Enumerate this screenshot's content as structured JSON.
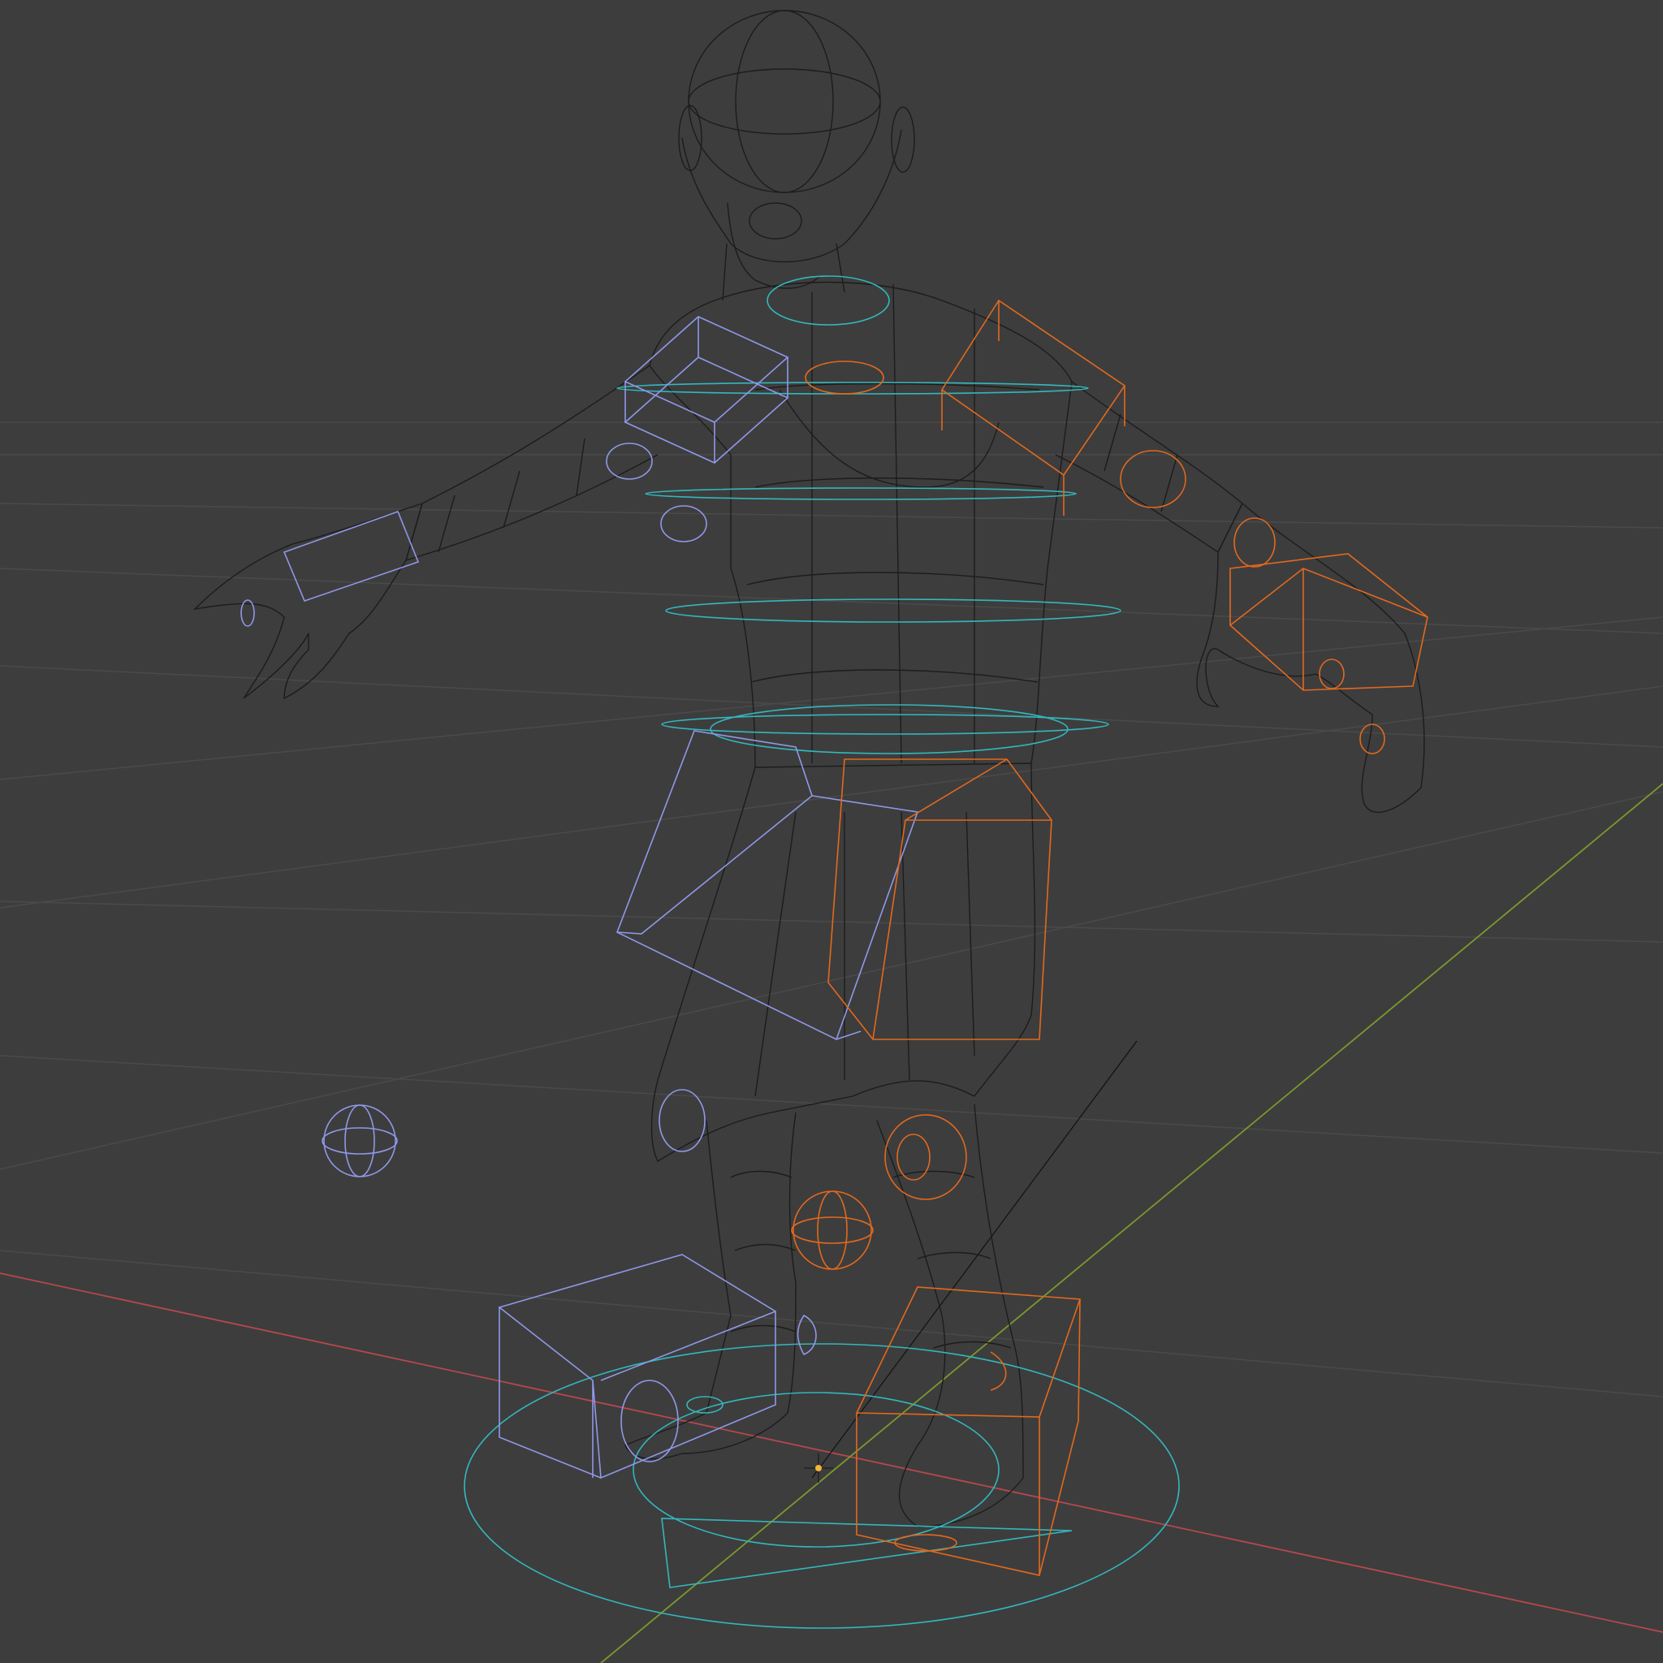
{
  "viewport": {
    "mode": "wireframe",
    "projection": "perspective"
  },
  "colors": {
    "background": "#3d3d3d",
    "grid_line": "#4a4a4a",
    "x_axis": "#b5484f",
    "y_axis": "#7a9a2c",
    "mesh_wire": "#1c1c1c",
    "control_cyan": "#33b7bd",
    "control_blue": "#8f98e8",
    "control_orange": "#e2691d",
    "origin_marker": "#f2b63a"
  },
  "scene": {
    "objects": [
      {
        "name": "character-mesh",
        "kind": "wireframe-mesh"
      },
      {
        "name": "armature-rig",
        "kind": "rig-controls"
      },
      {
        "name": "scene-origin",
        "kind": "origin-marker"
      }
    ]
  }
}
